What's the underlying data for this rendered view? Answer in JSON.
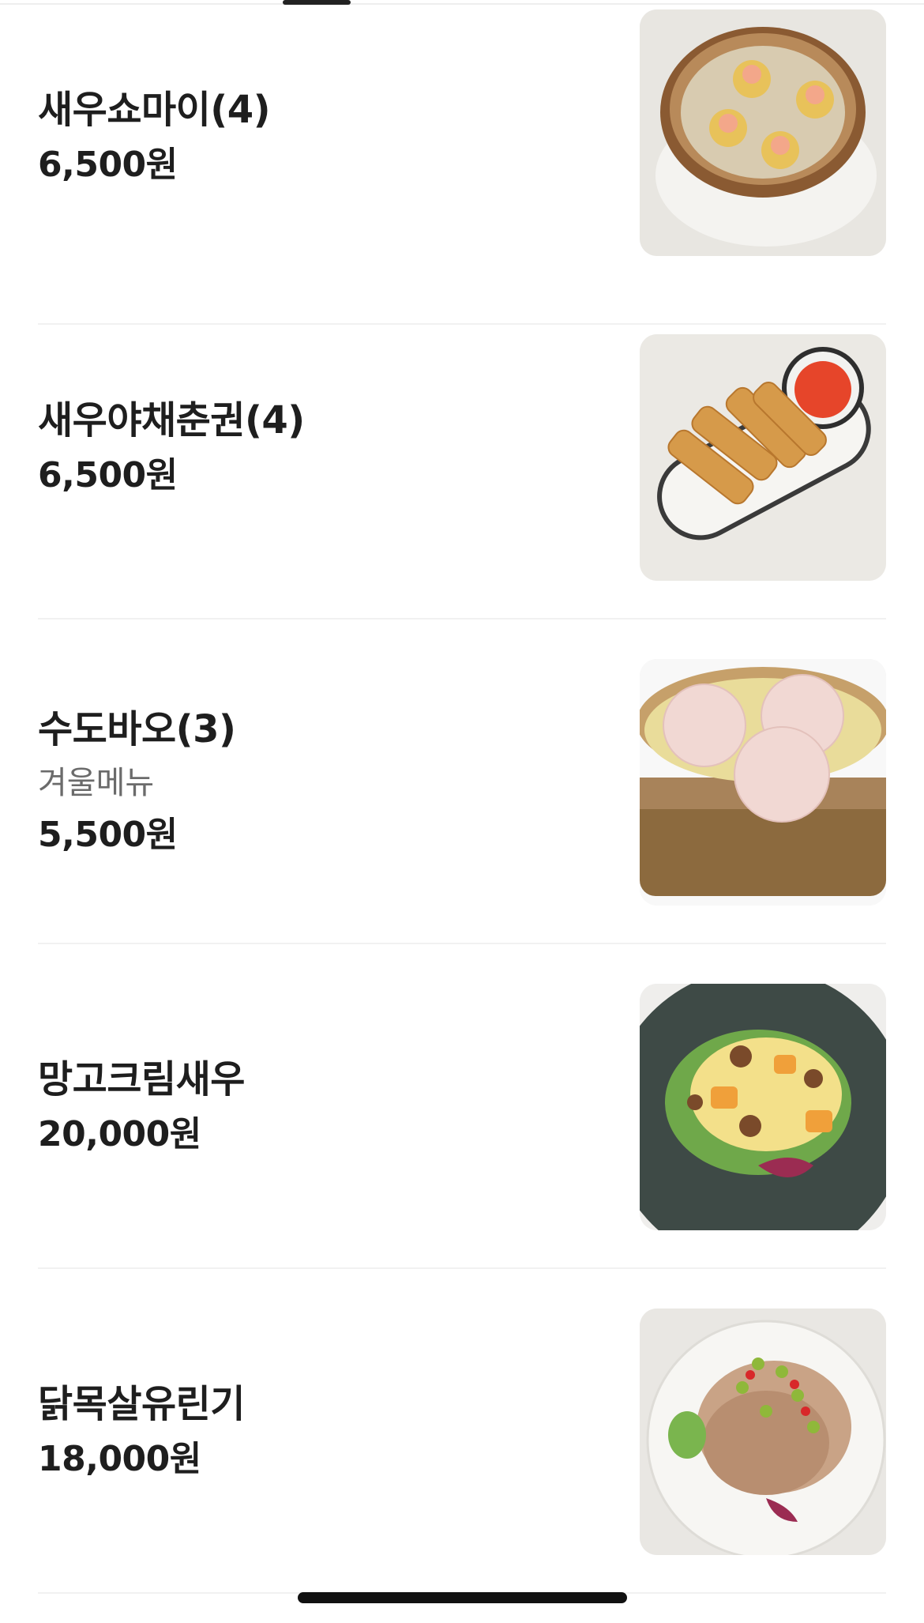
{
  "menu_items": [
    {
      "name": "새우쇼마이(4)",
      "description": "",
      "price": "6,500원",
      "image": "steamed shrimp shumai in bamboo basket"
    },
    {
      "name": "새우야채춘권(4)",
      "description": "",
      "price": "6,500원",
      "image": "spring rolls on oval plate with chili sauce"
    },
    {
      "name": "수도바오(3)",
      "description": "겨울메뉴",
      "price": "5,500원",
      "image": "steamed buns in bamboo steamer"
    },
    {
      "name": "망고크림새우",
      "description": "",
      "price": "20,000원",
      "image": "mango cream shrimp salad on dark plate"
    },
    {
      "name": "닭목살유린기",
      "description": "",
      "price": "18,000원",
      "image": "fried chicken with scallion sauce on white plate"
    }
  ]
}
